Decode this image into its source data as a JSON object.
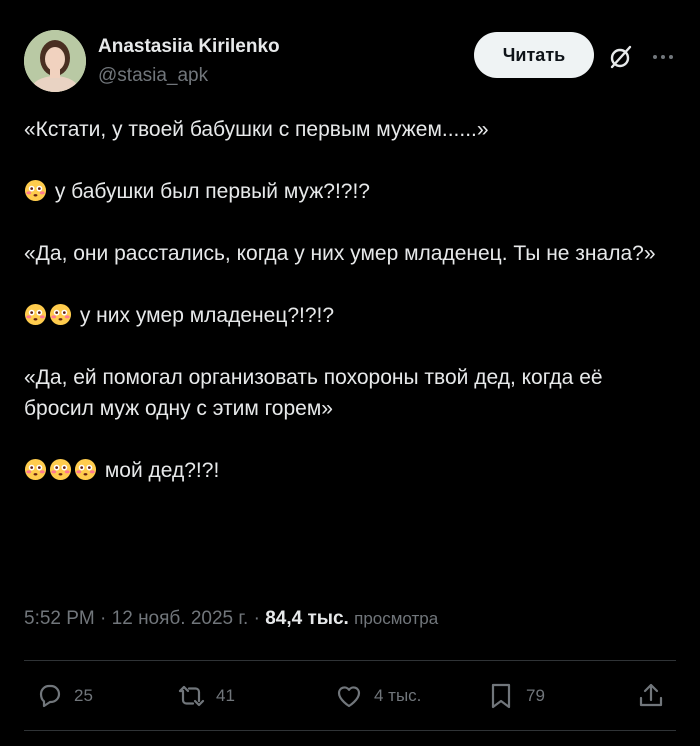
{
  "author": {
    "display_name": "Anastasiia Kirilenko",
    "handle": "@stasia_apk"
  },
  "header": {
    "follow_label": "Читать",
    "grok_icon": "slash-circle-icon",
    "more_icon": "more-icon"
  },
  "tweet": {
    "paragraphs": [
      {
        "emoji_count": 0,
        "text": "«Кстати, у твоей бабушки с первым мужем......»"
      },
      {
        "emoji_count": 1,
        "text": "у бабушки был первый муж?!?!?"
      },
      {
        "emoji_count": 0,
        "text": "«Да, они расстались, когда у них умер младенец. Ты не знала?»"
      },
      {
        "emoji_count": 2,
        "text": "у них умер младенец?!?!?"
      },
      {
        "emoji_count": 0,
        "text": "«Да, ей помогал организовать похороны твой дед, когда её бросил муж одну с этим горем»"
      },
      {
        "emoji_count": 3,
        "text": "мой дед?!?!"
      }
    ],
    "emoji_name": "flushed-face"
  },
  "meta": {
    "time": "5:52 PM",
    "separator": "·",
    "date": "12 нояб. 2025 г.",
    "views_count": "84,4 тыс.",
    "views_label": "просмотра"
  },
  "actions": {
    "reply_count": "25",
    "repost_count": "41",
    "like_count": "4 тыс.",
    "bookmark_count": "79"
  },
  "colors": {
    "background": "#000000",
    "text": "#e7e9ea",
    "muted": "#71767b",
    "divider": "#2f3336",
    "button_bg": "#eff3f4"
  }
}
